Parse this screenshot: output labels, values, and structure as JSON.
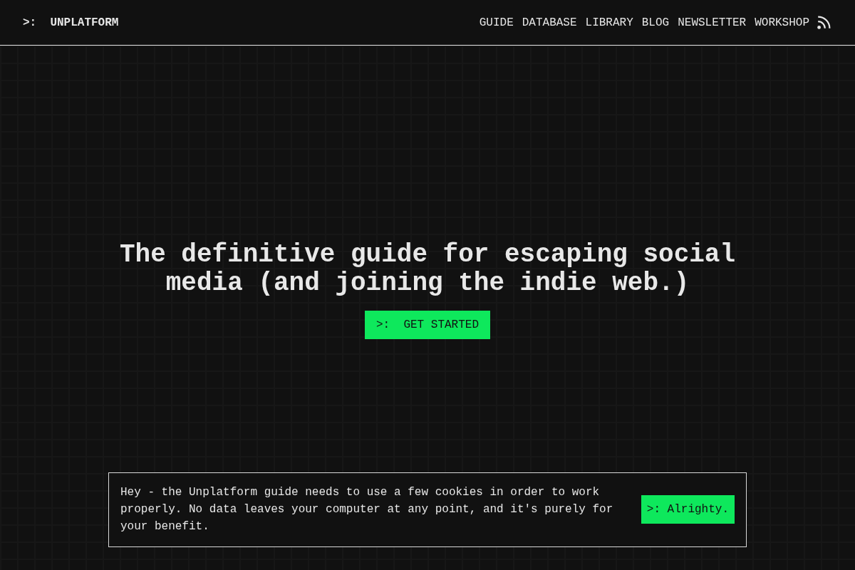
{
  "header": {
    "logo": ">:  UNPLATFORM",
    "nav": [
      "GUIDE",
      "DATABASE",
      "LIBRARY",
      "BLOG",
      "NEWSLETTER",
      "WORKSHOP"
    ]
  },
  "hero": {
    "heading": "The definitive guide for escaping social media (and joining the indie web.)",
    "button": ">:  GET STARTED"
  },
  "cookie_banner": {
    "message": "Hey - the Unplatform guide needs to use a few cookies in order to work properly. No data leaves your computer at any point, and it's purely for your benefit.",
    "button": ">: Alrighty."
  }
}
